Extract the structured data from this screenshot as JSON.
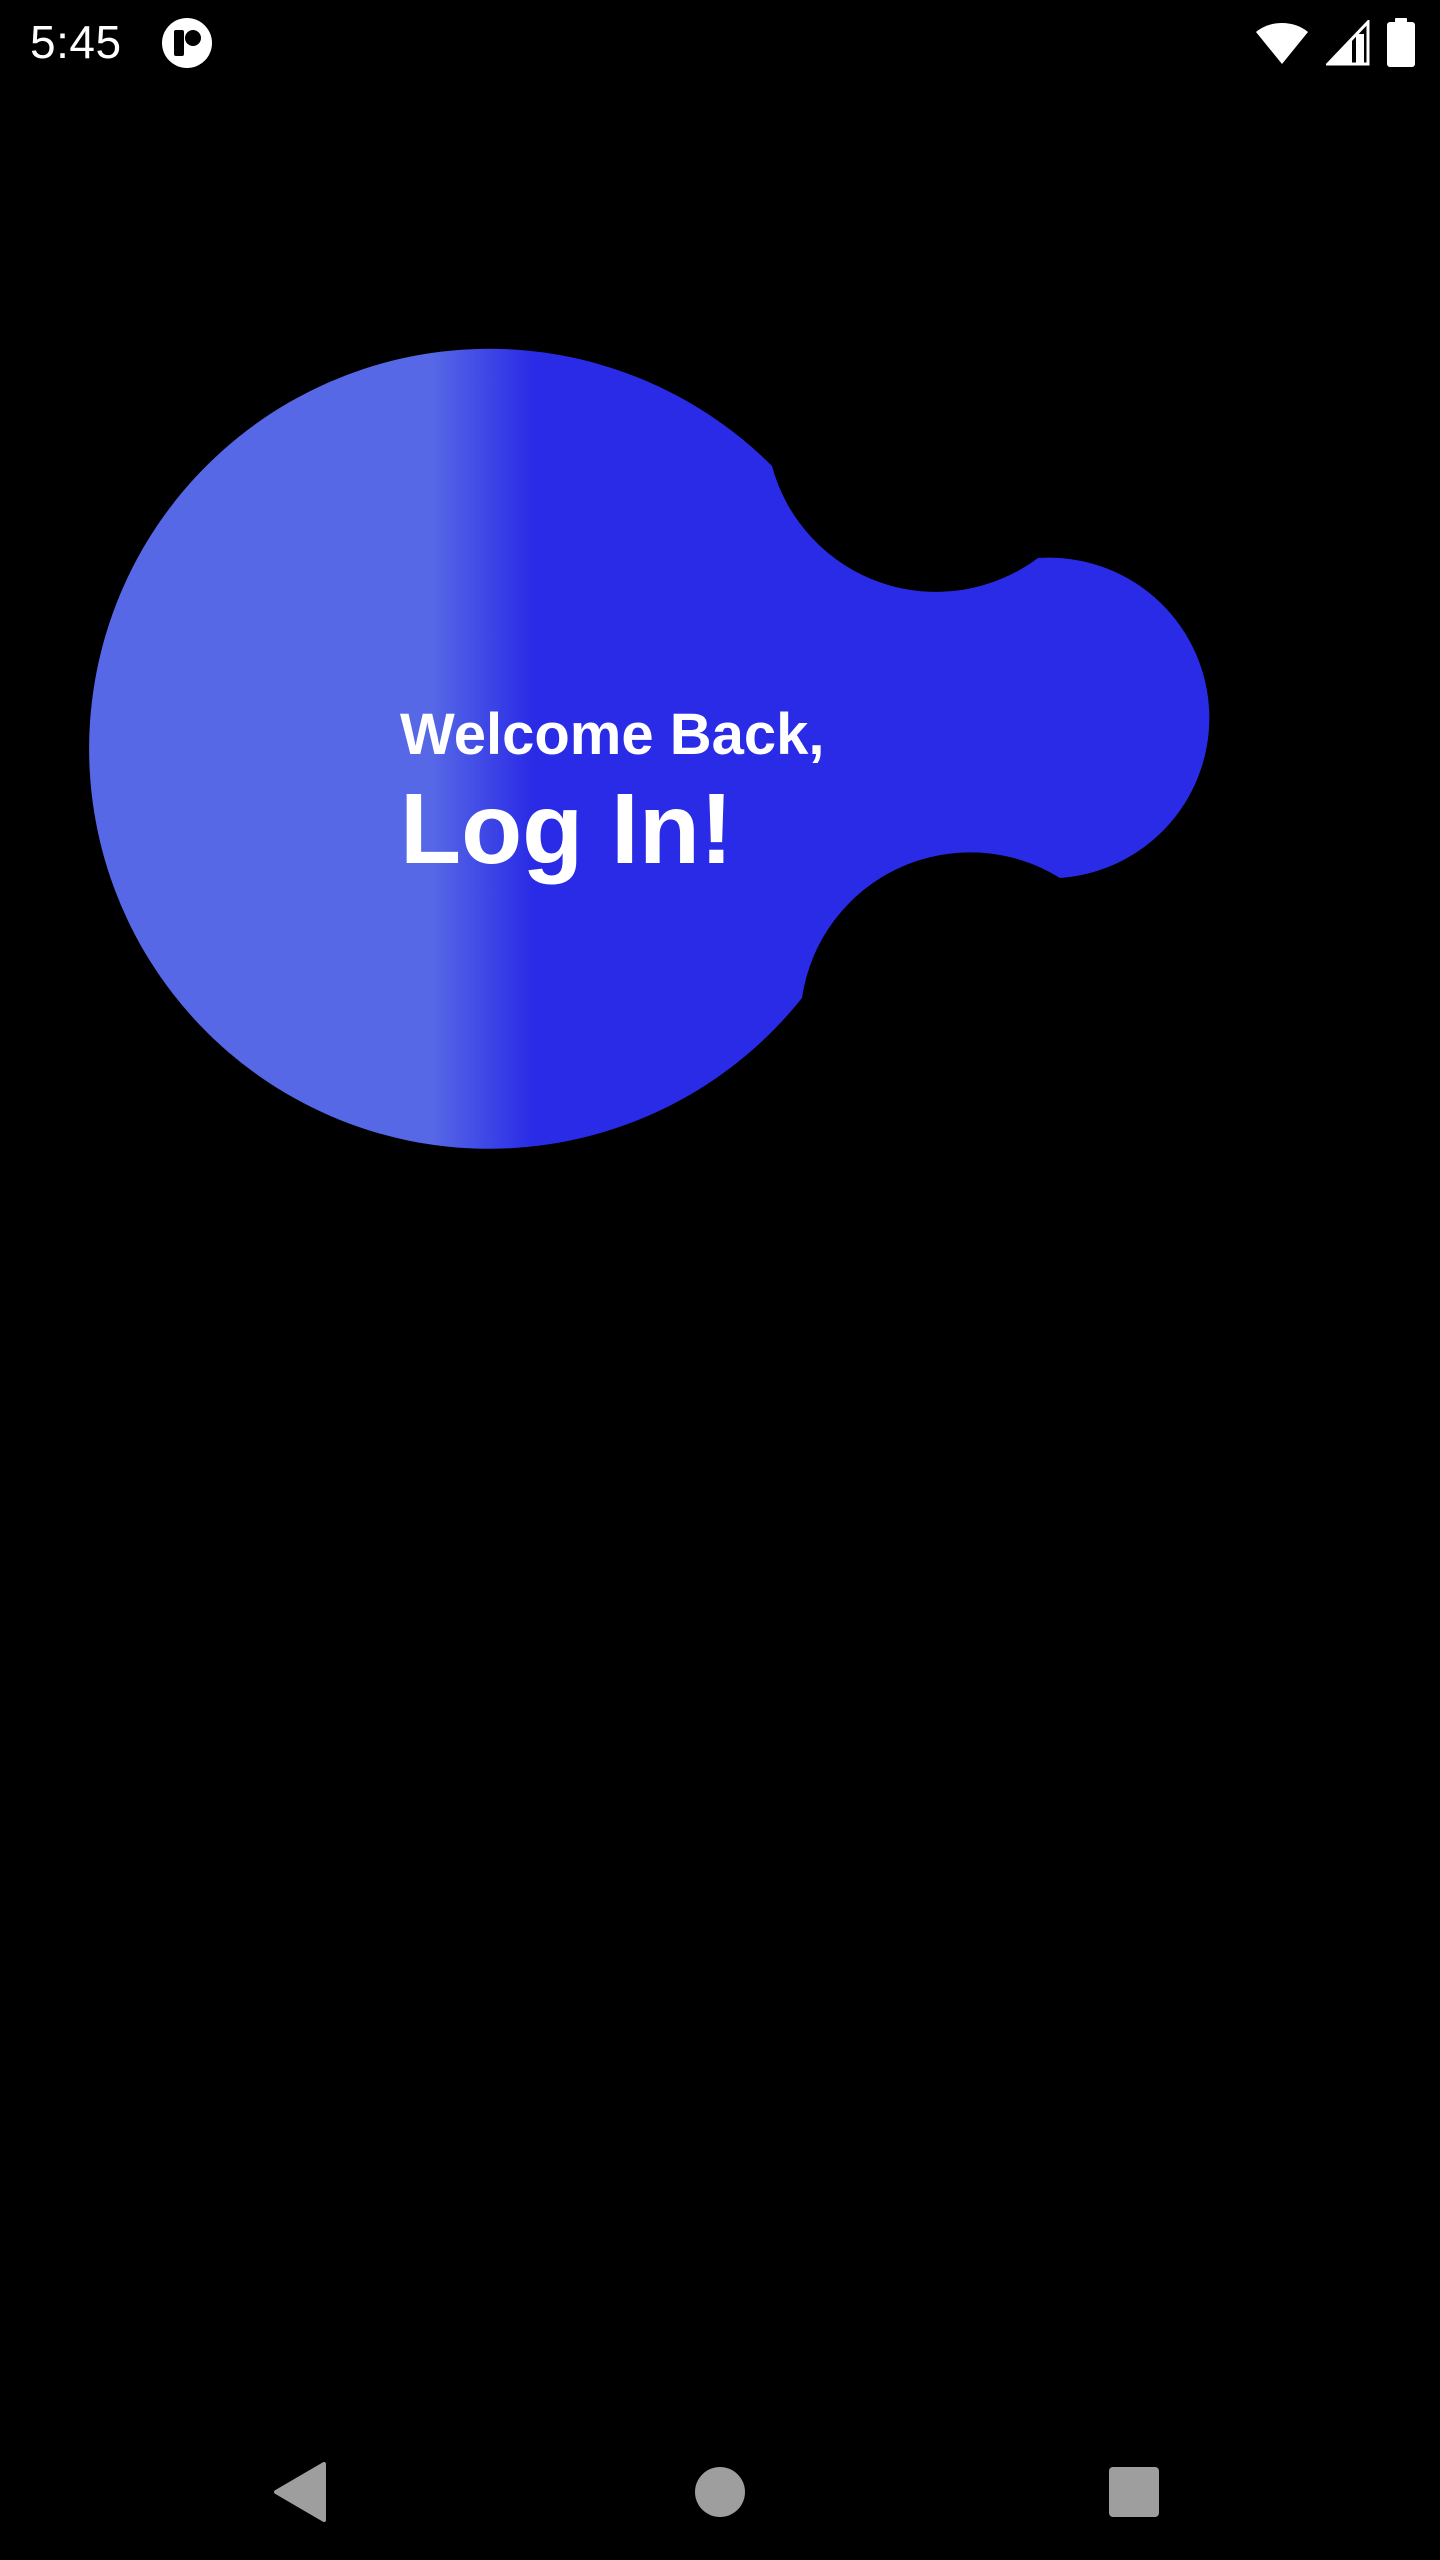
{
  "status_bar": {
    "time": "5:45",
    "app_icon": "app-notification-icon",
    "icons": [
      "wifi-icon",
      "cell-signal-icon",
      "battery-icon"
    ]
  },
  "hero": {
    "subtitle": "Welcome Back,",
    "title": "Log In!"
  },
  "colors": {
    "background": "#000000",
    "blob_light": "#5668E6",
    "blob_dark": "#2A2BE6",
    "text": "#FFFFFF",
    "nav_icons": "#9E9E9E"
  },
  "nav_bar": {
    "back_icon": "back-triangle-icon",
    "home_icon": "home-circle-icon",
    "recents_icon": "recents-square-icon"
  }
}
